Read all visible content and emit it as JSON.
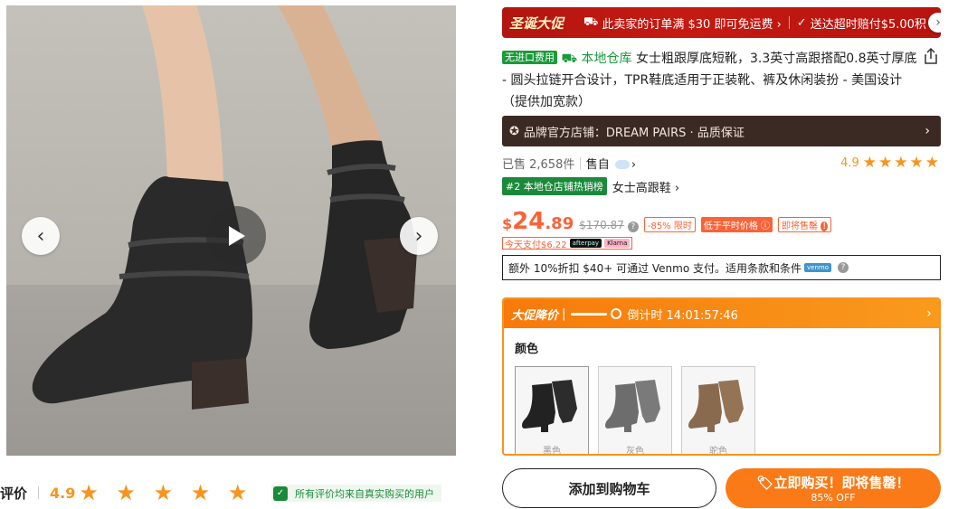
{
  "gallery": {
    "prev_icon": "chevron-left-icon",
    "next_icon": "chevron-right-icon",
    "play_icon": "play-icon"
  },
  "reviews": {
    "label": "评价",
    "score": "4.9",
    "stars": "★ ★ ★ ★ ★",
    "verified_text": "所有评价均来自真实购买的用户"
  },
  "banner": {
    "logo": "圣诞大促",
    "free_shipping": "此卖家的订单满 $30 即可免运费 ›",
    "late_comp": "送达超时赔付$5.00积"
  },
  "product": {
    "tag_free_import": "无进口费用",
    "tag_local": "本地仓库",
    "title": "女士粗跟厚底短靴，3.3英寸高跟搭配0.8英寸厚底 - 圆头拉链开合设计，TPR鞋底适用于正装靴、裤及休闲装扮 - 美国设计（提供加宽款）"
  },
  "brand": {
    "text": "品牌官方店铺：DREAM PAIRS · 品质保证"
  },
  "sales": {
    "sold": "已售 2,658件",
    "sold_by": "售自",
    "rating": "4.9",
    "stars": "★★★★★"
  },
  "rank": {
    "tag": "#2 本地仓店铺热销榜",
    "category": "女士高跟鞋 ›"
  },
  "price": {
    "currency": "$",
    "integer": "24",
    "decimal": ".89",
    "original": "$170.87",
    "discount": "-85% 限时",
    "lower_than_usual": "低于平时价格",
    "selling_out": "即将售罄",
    "pay_today": "今天支付$6.22",
    "afterpay": "afterpay",
    "klarna": "Klarna"
  },
  "venmo": {
    "text_before": "额外 10%折扣 $40+ 可通过 Venmo 支付。适用条款和条件",
    "logo": "venmo"
  },
  "promo": {
    "title": "大促降价",
    "countdown": "倒计时 14:01:57:46",
    "color_label": "颜色",
    "colors": [
      "黑色",
      "灰色",
      "驼色"
    ]
  },
  "actions": {
    "add_to_cart": "添加到购物车",
    "buy_now": "立即购买！即将售罄！",
    "buy_sub": "85% OFF"
  },
  "colors": {
    "accent": "#fa6338",
    "green": "#1a9a3a",
    "star": "#f7941d",
    "banner_red": "#c41a12",
    "brand_bar": "#3b2a23"
  }
}
